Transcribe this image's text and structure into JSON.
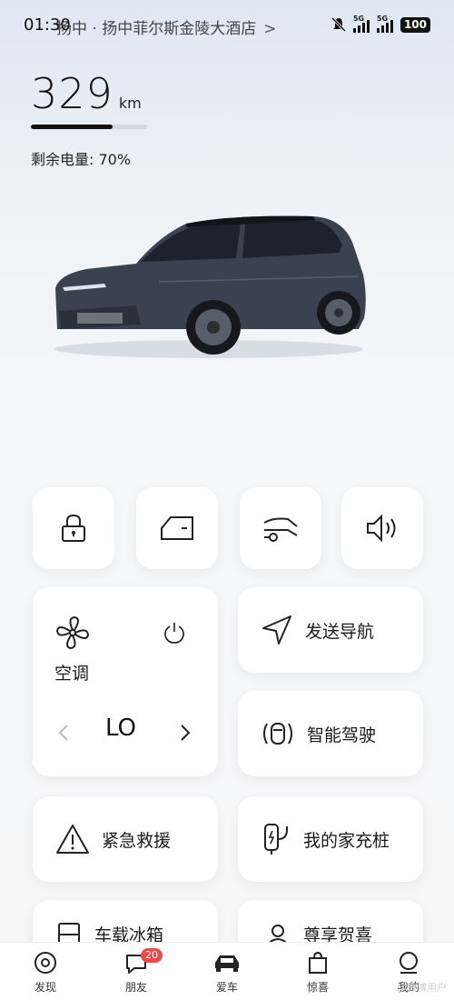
{
  "status_bar": {
    "time": "01:30",
    "location": "扬中 · 扬中菲尔斯金陵大酒店",
    "network_1": "5G",
    "network_2": "5G",
    "battery": "100"
  },
  "vehicle": {
    "range_value": "329",
    "range_unit": "km",
    "battery_label": "剩余电量: 70%",
    "battery_fraction": 0.7,
    "body_color": "#3a4250"
  },
  "quick_actions": [
    {
      "icon": "lock-icon"
    },
    {
      "icon": "car-door-icon"
    },
    {
      "icon": "tailgate-icon"
    },
    {
      "icon": "speaker-icon"
    }
  ],
  "climate": {
    "title": "空调",
    "level": "LO"
  },
  "cards": {
    "send_navigation": "发送导航",
    "smart_driving": "智能驾驶",
    "emergency_rescue": "紧急救援",
    "home_charger": "我的家充桩",
    "car_fridge": "车载冰箱",
    "welcome": "尊享贺喜"
  },
  "tabs": [
    {
      "label": "发现",
      "icon": "discover-icon"
    },
    {
      "label": "朋友",
      "icon": "chat-icon",
      "badge": "20"
    },
    {
      "label": "爱车",
      "icon": "car-icon"
    },
    {
      "label": "惊喜",
      "icon": "shopping-bag-icon"
    },
    {
      "label": "我的",
      "icon": "profile-icon"
    }
  ],
  "watermark": "@微博用户"
}
